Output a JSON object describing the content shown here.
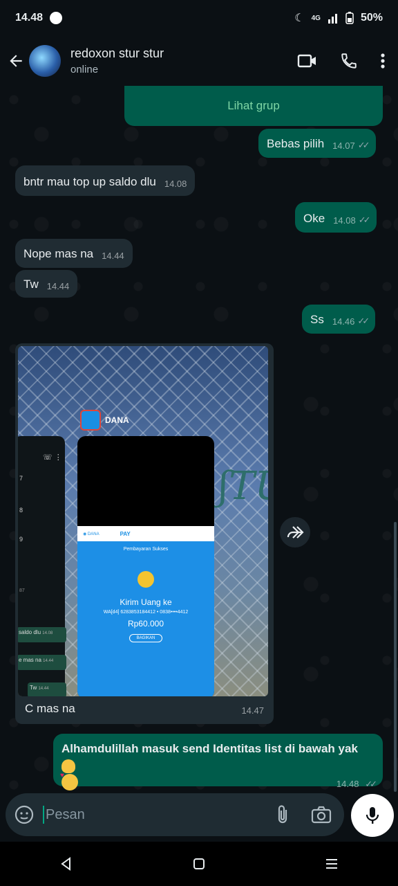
{
  "status": {
    "time": "14.48",
    "battery": "50%",
    "network": "4G"
  },
  "header": {
    "contact_name": "redoxon stur stur",
    "contact_status": "online"
  },
  "messages": {
    "group_link": "Lihat grup",
    "m1": {
      "text": "Bebas pilih",
      "time": "14.07"
    },
    "m2": {
      "text": "bntr mau top up saldo dlu",
      "time": "14.08"
    },
    "m3": {
      "text": "Oke",
      "time": "14.08"
    },
    "m4": {
      "text": "Nope mas na",
      "time": "14.44"
    },
    "m5": {
      "text": "Tw",
      "time": "14.44"
    },
    "m6": {
      "text": "Ss",
      "time": "14.46"
    },
    "m7": {
      "caption": "C mas na",
      "time": "14.47"
    },
    "m8": {
      "text": "Alhamdulillah masuk send Identitas list di bawah yak",
      "time": "14.48"
    }
  },
  "screenshot": {
    "app_label": "DANA",
    "pay_label": "PAY",
    "title": "Pembayaran Sukses",
    "heading": "Kirim Uang ke",
    "recipient": "WA[d4] 6283853184412 • 0838••••4412",
    "amount": "Rp60.000",
    "share_button": "BAGIKAN",
    "side_texts": [
      "saldo dlu",
      "e mas na",
      "Tw"
    ],
    "side_times": [
      "14.08",
      "14.44",
      "14.44"
    ],
    "side_numbers": [
      "7",
      "8",
      "9",
      "87"
    ]
  },
  "composer": {
    "placeholder": "Pesan"
  },
  "colors": {
    "outgoing": "#005c4b",
    "incoming": "#202c33",
    "background": "#0b1014"
  }
}
